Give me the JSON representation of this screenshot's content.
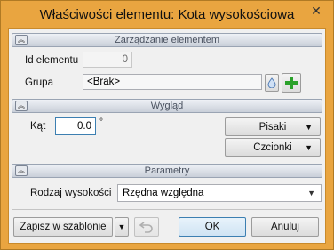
{
  "window": {
    "title": "Właściwości elementu: Kota wysokościowa",
    "close_glyph": "✕"
  },
  "sections": {
    "management": {
      "title": "Zarządzanie elementem"
    },
    "appearance": {
      "title": "Wygląd"
    },
    "parameters": {
      "title": "Parametry"
    }
  },
  "management": {
    "id_label": "Id elementu",
    "id_value": "0",
    "group_label": "Grupa",
    "group_value": "<Brak>",
    "group_icon": "drop-icon",
    "add_icon": "plus-icon",
    "add_color": "#2aa12a"
  },
  "appearance": {
    "angle_label": "Kąt",
    "angle_value": "0.0",
    "angle_unit": "°",
    "pens_label": "Pisaki",
    "fonts_label": "Czcionki"
  },
  "parameters": {
    "height_type_label": "Rodzaj wysokości",
    "height_type_value": "Rzędna względna"
  },
  "footer": {
    "save_template_label": "Zapisz w szablonie",
    "ok_label": "OK",
    "cancel_label": "Anuluj",
    "undo_icon": "undo-icon"
  },
  "colors": {
    "frame": "#e9a540",
    "dialog_bg": "#f0f0f0",
    "accent": "#3c7fb1"
  }
}
